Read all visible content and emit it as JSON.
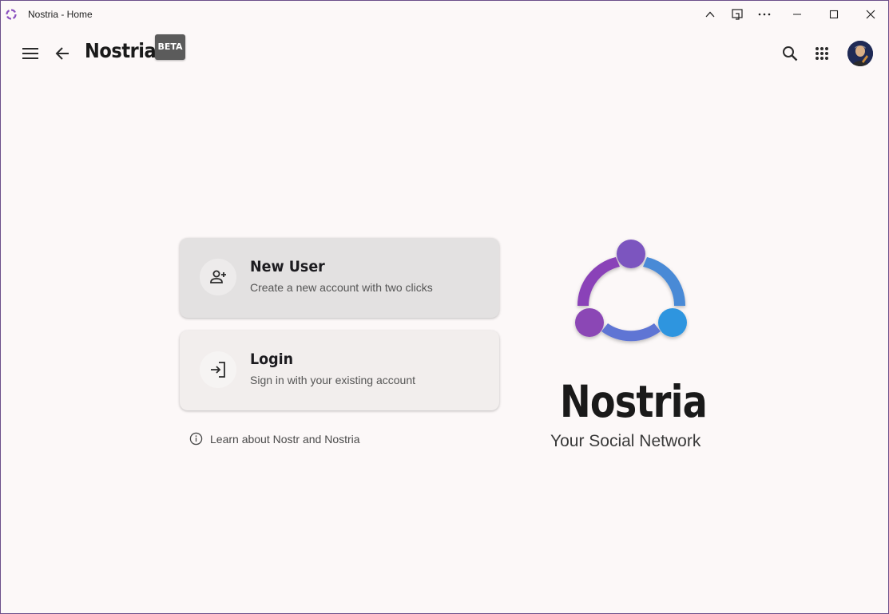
{
  "window": {
    "title": "Nostria - Home",
    "controls": [
      "chevron-up-icon",
      "cast-icon",
      "more-icon",
      "minimize-icon",
      "maximize-icon",
      "close-icon"
    ]
  },
  "header": {
    "brand": "Nostria",
    "badge": "BETA",
    "icons": [
      "menu-icon",
      "back-arrow-icon",
      "search-icon",
      "apps-grid-icon"
    ]
  },
  "cards": {
    "new_user": {
      "title": "New User",
      "subtitle": "Create a new account with two clicks",
      "icon": "person-add-icon"
    },
    "login": {
      "title": "Login",
      "subtitle": "Sign in with your existing account",
      "icon": "login-icon"
    }
  },
  "learn_link": {
    "label": "Learn about Nostr and Nostria",
    "icon": "info-icon"
  },
  "hero": {
    "name": "Nostria",
    "tagline": "Your Social Network"
  },
  "colors": {
    "accent_purple": "#8a3fb6",
    "accent_blue": "#2f9be0",
    "background": "#fcf8f8"
  }
}
